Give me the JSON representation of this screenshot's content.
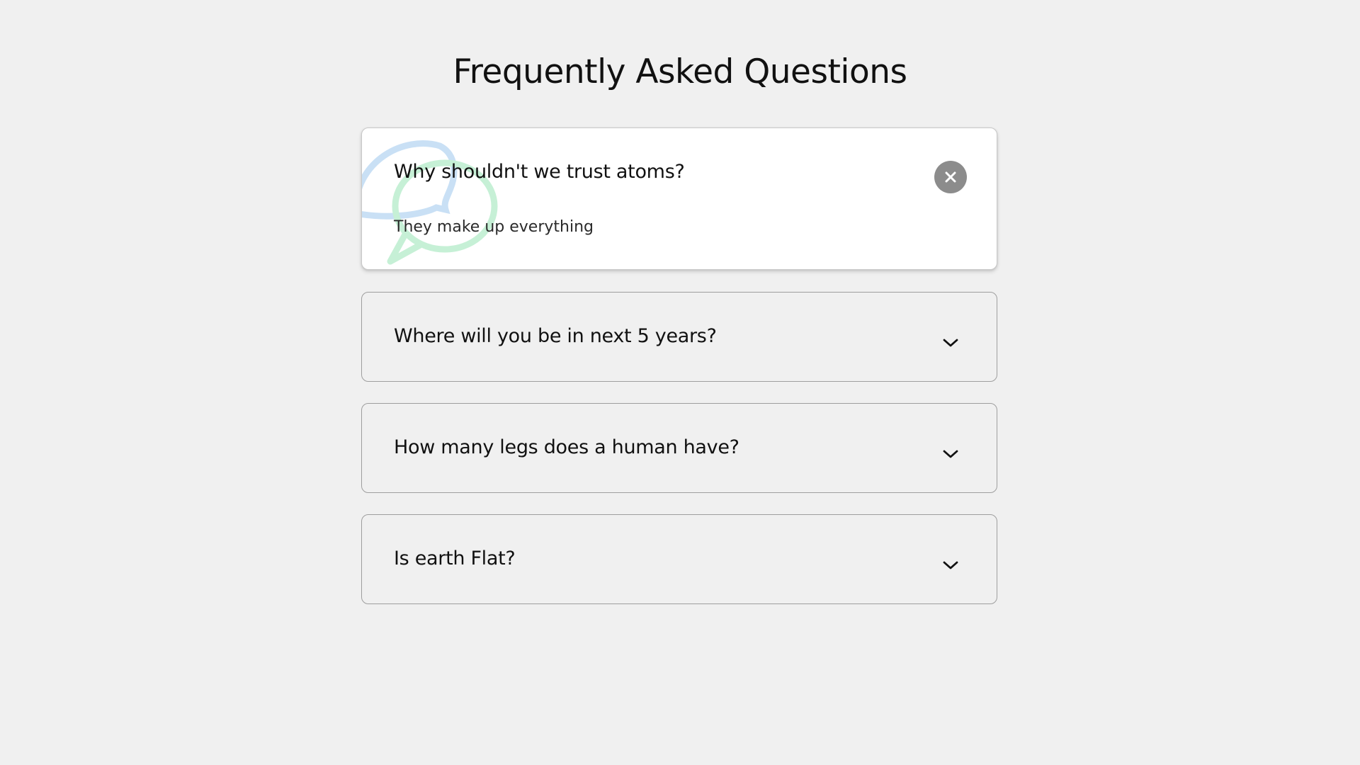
{
  "page": {
    "title": "Frequently Asked Questions"
  },
  "faq": {
    "items": [
      {
        "question": "Why shouldn't we trust atoms?",
        "answer": "They make up everything",
        "expanded": true,
        "toggle_icon": "close-icon"
      },
      {
        "question": "Where will you be in next 5 years?",
        "expanded": false,
        "toggle_icon": "chevron-down-icon"
      },
      {
        "question": "How many legs does a human have?",
        "expanded": false,
        "toggle_icon": "chevron-down-icon"
      },
      {
        "question": "Is earth Flat?",
        "expanded": false,
        "toggle_icon": "chevron-down-icon"
      }
    ]
  },
  "colors": {
    "background": "#f0f0f0",
    "card_active": "#ffffff",
    "card_border": "#9e9e9e",
    "close_button": "#8c8c8c",
    "deco_blue": "#c9e0f5",
    "deco_green": "#c6f0d6",
    "text": "#111111"
  }
}
